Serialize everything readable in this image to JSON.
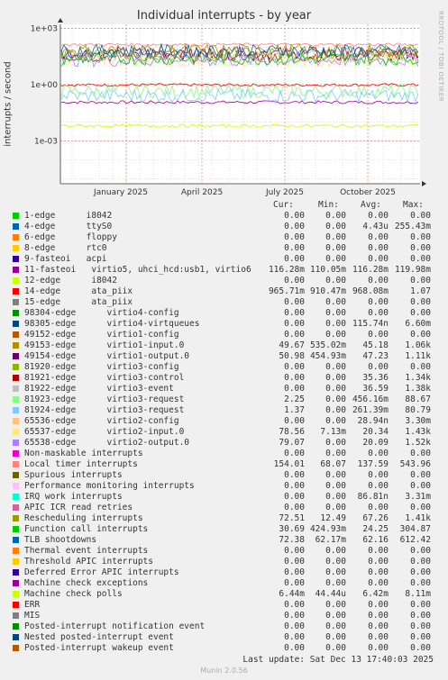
{
  "chart_data": {
    "type": "line",
    "title": "Individual interrupts - by year",
    "ylabel": "interrupts / second",
    "y_scale": "log",
    "yticks": [
      "1e+03",
      "1e+00",
      "1e-03"
    ],
    "xticks": [
      "January 2025",
      "April 2025",
      "July 2025",
      "October 2025"
    ],
    "side_text": "RRDTOOL / TOBI OETIKER",
    "columns": [
      "Cur:",
      "Min:",
      "Avg:",
      "Max:"
    ],
    "series": [
      {
        "name": "1-edge      i8042",
        "color": "#00cc00",
        "cur": "0.00",
        "min": "0.00",
        "avg": "0.00",
        "max": "0.00"
      },
      {
        "name": "4-edge      ttyS0",
        "color": "#0066b3",
        "cur": "0.00",
        "min": "0.00",
        "avg": "4.43u",
        "max": "255.43m"
      },
      {
        "name": "6-edge      floppy",
        "color": "#ff8000",
        "cur": "0.00",
        "min": "0.00",
        "avg": "0.00",
        "max": "0.00"
      },
      {
        "name": "8-edge      rtc0",
        "color": "#ffcc00",
        "cur": "0.00",
        "min": "0.00",
        "avg": "0.00",
        "max": "0.00"
      },
      {
        "name": "9-fasteoi   acpi",
        "color": "#330099",
        "cur": "0.00",
        "min": "0.00",
        "avg": "0.00",
        "max": "0.00"
      },
      {
        "name": "11-fasteoi   virtio5, uhci_hcd:usb1, virtio6",
        "color": "#990099",
        "cur": "116.28m",
        "min": "110.05m",
        "avg": "116.28m",
        "max": "119.98m"
      },
      {
        "name": "12-edge      i8042",
        "color": "#ccff00",
        "cur": "0.00",
        "min": "0.00",
        "avg": "0.00",
        "max": "0.00"
      },
      {
        "name": "14-edge      ata_piix",
        "color": "#ff0000",
        "cur": "965.71m",
        "min": "910.47m",
        "avg": "968.08m",
        "max": "1.07"
      },
      {
        "name": "15-edge      ata_piix",
        "color": "#808080",
        "cur": "0.00",
        "min": "0.00",
        "avg": "0.00",
        "max": "0.00"
      },
      {
        "name": "98304-edge      virtio4-config",
        "color": "#008f00",
        "cur": "0.00",
        "min": "0.00",
        "avg": "0.00",
        "max": "0.00"
      },
      {
        "name": "98305-edge      virtio4-virtqueues",
        "color": "#00487d",
        "cur": "0.00",
        "min": "0.00",
        "avg": "115.74n",
        "max": "6.60m"
      },
      {
        "name": "49152-edge      virtio1-config",
        "color": "#b35a00",
        "cur": "0.00",
        "min": "0.00",
        "avg": "0.00",
        "max": "0.00"
      },
      {
        "name": "49153-edge      virtio1-input.0",
        "color": "#b38f00",
        "cur": "49.67",
        "min": "535.02m",
        "avg": "45.18",
        "max": "1.06k"
      },
      {
        "name": "49154-edge      virtio1-output.0",
        "color": "#6b006b",
        "cur": "50.98",
        "min": "454.93m",
        "avg": "47.23",
        "max": "1.11k"
      },
      {
        "name": "81920-edge      virtio3-config",
        "color": "#8fb300",
        "cur": "0.00",
        "min": "0.00",
        "avg": "0.00",
        "max": "0.00"
      },
      {
        "name": "81921-edge      virtio3-control",
        "color": "#b30000",
        "cur": "0.00",
        "min": "0.00",
        "avg": "35.36",
        "max": "1.34k"
      },
      {
        "name": "81922-edge      virtio3-event",
        "color": "#bebebe",
        "cur": "0.00",
        "min": "0.00",
        "avg": "36.59",
        "max": "1.38k"
      },
      {
        "name": "81923-edge      virtio3-request",
        "color": "#80ff80",
        "cur": "2.25",
        "min": "0.00",
        "avg": "456.16m",
        "max": "88.67"
      },
      {
        "name": "81924-edge      virtio3-request",
        "color": "#80c9ff",
        "cur": "1.37",
        "min": "0.00",
        "avg": "261.39m",
        "max": "80.79"
      },
      {
        "name": "65536-edge      virtio2-config",
        "color": "#ffc080",
        "cur": "0.00",
        "min": "0.00",
        "avg": "28.94n",
        "max": "3.30m"
      },
      {
        "name": "65537-edge      virtio2-input.0",
        "color": "#ffe680",
        "cur": "78.56",
        "min": "7.13m",
        "avg": "20.34",
        "max": "1.43k"
      },
      {
        "name": "65538-edge      virtio2-output.0",
        "color": "#aa80ff",
        "cur": "79.07",
        "min": "0.00",
        "avg": "20.09",
        "max": "1.52k"
      },
      {
        "name": "Non-maskable interrupts",
        "color": "#ee00cc",
        "cur": "0.00",
        "min": "0.00",
        "avg": "0.00",
        "max": "0.00"
      },
      {
        "name": "Local timer interrupts",
        "color": "#ff8080",
        "cur": "154.01",
        "min": "68.07",
        "avg": "137.59",
        "max": "543.96"
      },
      {
        "name": "Spurious interrupts",
        "color": "#666600",
        "cur": "0.00",
        "min": "0.00",
        "avg": "0.00",
        "max": "0.00"
      },
      {
        "name": "Performance monitoring interrupts",
        "color": "#ffbfff",
        "cur": "0.00",
        "min": "0.00",
        "avg": "0.00",
        "max": "0.00"
      },
      {
        "name": "IRQ work interrupts",
        "color": "#00ffcc",
        "cur": "0.00",
        "min": "0.00",
        "avg": "86.81n",
        "max": "3.31m"
      },
      {
        "name": "APIC ICR read retries",
        "color": "#cc6699",
        "cur": "0.00",
        "min": "0.00",
        "avg": "0.00",
        "max": "0.00"
      },
      {
        "name": "Rescheduling interrupts",
        "color": "#999900",
        "cur": "72.51",
        "min": "12.49",
        "avg": "67.26",
        "max": "1.41k"
      },
      {
        "name": "Function call interrupts",
        "color": "#00cc00",
        "cur": "30.69",
        "min": "424.93m",
        "avg": "24.25",
        "max": "304.87"
      },
      {
        "name": "TLB shootdowns",
        "color": "#0066b3",
        "cur": "72.38",
        "min": "62.17m",
        "avg": "62.16",
        "max": "612.42"
      },
      {
        "name": "Thermal event interrupts",
        "color": "#ff8000",
        "cur": "0.00",
        "min": "0.00",
        "avg": "0.00",
        "max": "0.00"
      },
      {
        "name": "Threshold APIC interrupts",
        "color": "#ffcc00",
        "cur": "0.00",
        "min": "0.00",
        "avg": "0.00",
        "max": "0.00"
      },
      {
        "name": "Deferred Error APIC interrupts",
        "color": "#330099",
        "cur": "0.00",
        "min": "0.00",
        "avg": "0.00",
        "max": "0.00"
      },
      {
        "name": "Machine check exceptions",
        "color": "#990099",
        "cur": "0.00",
        "min": "0.00",
        "avg": "0.00",
        "max": "0.00"
      },
      {
        "name": "Machine check polls",
        "color": "#ccff00",
        "cur": "6.44m",
        "min": "44.44u",
        "avg": "6.42m",
        "max": "8.11m"
      },
      {
        "name": "ERR",
        "color": "#ff0000",
        "cur": "0.00",
        "min": "0.00",
        "avg": "0.00",
        "max": "0.00"
      },
      {
        "name": "MIS",
        "color": "#808080",
        "cur": "0.00",
        "min": "0.00",
        "avg": "0.00",
        "max": "0.00"
      },
      {
        "name": "Posted-interrupt notification event",
        "color": "#008f00",
        "cur": "0.00",
        "min": "0.00",
        "avg": "0.00",
        "max": "0.00"
      },
      {
        "name": "Nested posted-interrupt event",
        "color": "#00487d",
        "cur": "0.00",
        "min": "0.00",
        "avg": "0.00",
        "max": "0.00"
      },
      {
        "name": "Posted-interrupt wakeup event",
        "color": "#b35a00",
        "cur": "0.00",
        "min": "0.00",
        "avg": "0.00",
        "max": "0.00"
      }
    ],
    "last_update": "Last update: Sat Dec 13 17:40:03 2025",
    "footer": "Munin 2.0.56"
  }
}
